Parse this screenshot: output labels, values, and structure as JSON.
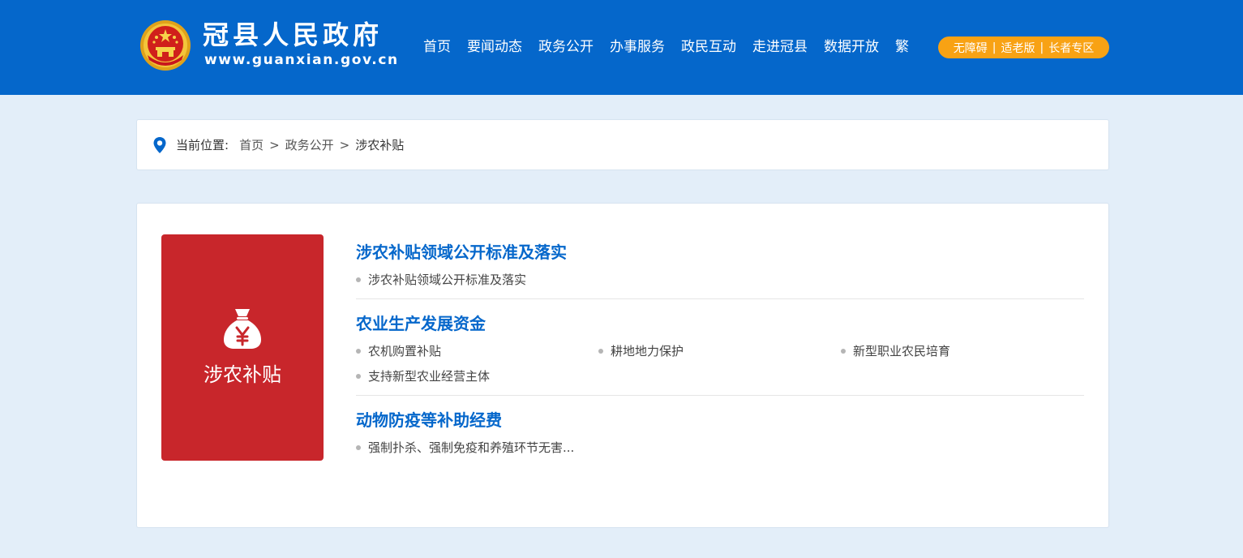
{
  "header": {
    "site_title": "冠县人民政府",
    "site_url": "www.guanxian.gov.cn",
    "nav": [
      "首页",
      "要闻动态",
      "政务公开",
      "办事服务",
      "政民互动",
      "走进冠县",
      "数据开放",
      "繁"
    ],
    "access": [
      "无障碍",
      "适老版",
      "长者专区"
    ],
    "access_separator": "|",
    "colors": {
      "header_bg": "#0567cb",
      "access_bg": "#f8a214"
    }
  },
  "breadcrumb": {
    "icon": "location-pin-icon",
    "prefix": "当前位置:",
    "items": [
      "首页",
      "政务公开",
      "涉农补贴"
    ],
    "separator": ">"
  },
  "main": {
    "card": {
      "label": "涉农补贴",
      "icon": "money-bag-icon",
      "color": "#c8262b"
    },
    "sections": [
      {
        "title": "涉农补贴领域公开标准及落实",
        "items": [
          "涉农补贴领域公开标准及落实"
        ]
      },
      {
        "title": "农业生产发展资金",
        "items": [
          "农机购置补贴",
          "耕地地力保护",
          "新型职业农民培育",
          "支持新型农业经营主体"
        ]
      },
      {
        "title": "动物防疫等补助经费",
        "items": [
          "强制扑杀、强制免疫和养殖环节无害..."
        ]
      }
    ]
  }
}
